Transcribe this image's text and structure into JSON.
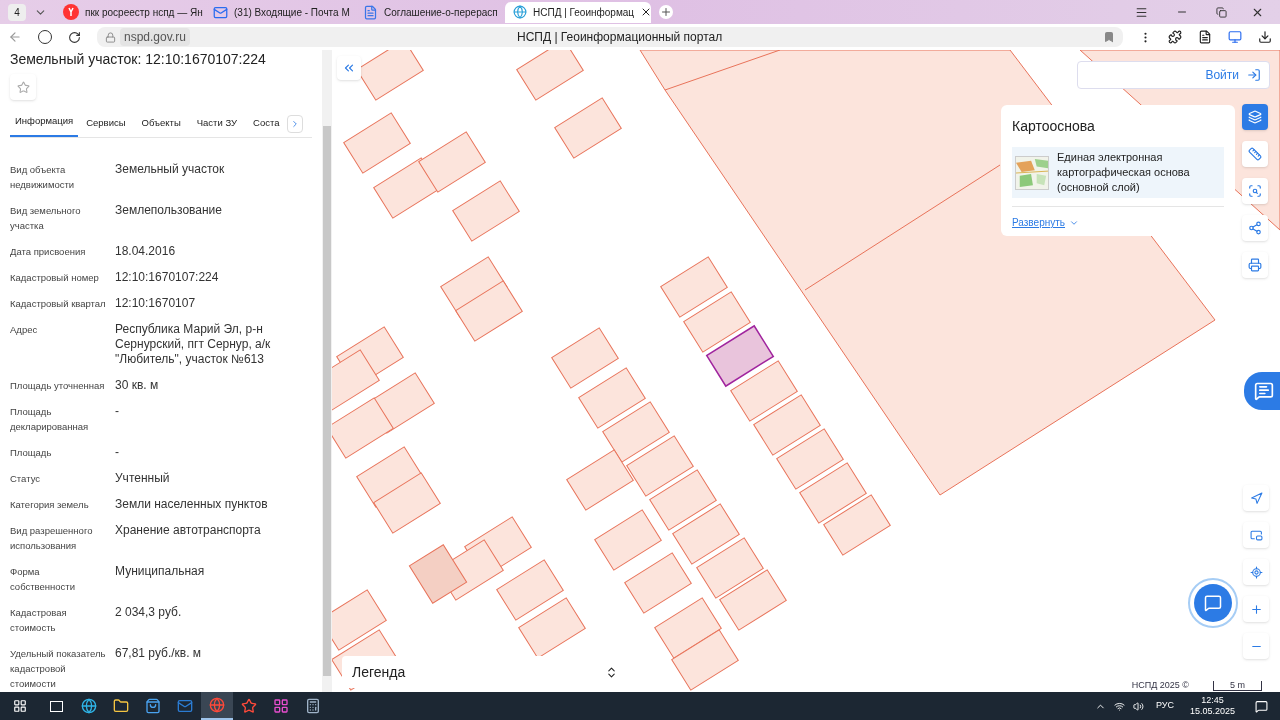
{
  "browser": {
    "tab_count": "4",
    "tabs": [
      {
        "title": "пкк росреестр нспд — Ян",
        "selected": false,
        "kind": "search"
      },
      {
        "title": "(31) Входящие - Почта М",
        "selected": false,
        "kind": "mail"
      },
      {
        "title": "Соглашение-о-перерасп",
        "selected": false,
        "kind": "doc"
      },
      {
        "title": "НСПД | Геоинформац",
        "selected": true,
        "kind": "site"
      }
    ],
    "url": "nspd.gov.ru",
    "page_title": "НСПД | Геоинформационный портал"
  },
  "panel": {
    "title": "Земельный участок: 12:10:1670107:224",
    "tabs": [
      {
        "label": "Информация",
        "selected": true
      },
      {
        "label": "Сервисы",
        "selected": false
      },
      {
        "label": "Объекты",
        "selected": false
      },
      {
        "label": "Части ЗУ",
        "selected": false
      },
      {
        "label": "Соста",
        "selected": false
      }
    ],
    "fields": [
      {
        "label": "Вид объекта недвижимости",
        "value": "Земельный участок"
      },
      {
        "label": "Вид земельного участка",
        "value": "Землепользование"
      },
      {
        "label": "Дата присвоения",
        "value": "18.04.2016"
      },
      {
        "label": "Кадастровый номер",
        "value": "12:10:1670107:224"
      },
      {
        "label": "Кадастровый квартал",
        "value": "12:10:1670107"
      },
      {
        "label": "Адрес",
        "value": "Республика Марий Эл, р-н Сернурский, пгт Сернур, а/к \"Любитель\", участок №613"
      },
      {
        "label": "Площадь уточненная",
        "value": "30 кв. м"
      },
      {
        "label": "Площадь декларированная",
        "value": "-"
      },
      {
        "label": "Площадь",
        "value": "-"
      },
      {
        "label": "Статус",
        "value": "Учтенный"
      },
      {
        "label": "Категория земель",
        "value": "Земли населенных пунктов"
      },
      {
        "label": "Вид разрешенного использования",
        "value": "Хранение автотранспорта"
      },
      {
        "label": "Форма собственности",
        "value": "Муниципальная"
      },
      {
        "label": "Кадастровая стоимость",
        "value": "2 034,3 руб."
      },
      {
        "label": "Удельный показатель кадастровой стоимости",
        "value": "67,81 руб./кв. м"
      }
    ]
  },
  "map": {
    "login_button": "Войти",
    "basemap": {
      "title": "Картооснова",
      "layer_name": "Единая электронная картографическая основа (основной слой)",
      "expand_link": "Развернуть"
    },
    "tools": [
      {
        "kind": "layers",
        "selected": true
      },
      {
        "kind": "ruler",
        "selected": false
      },
      {
        "kind": "select",
        "selected": false
      },
      {
        "kind": "share",
        "selected": false
      },
      {
        "kind": "print",
        "selected": false
      }
    ],
    "legend_title": "Легенда",
    "copyright": "НСПД 2025 ©",
    "scale": "5 m"
  },
  "taskbar": {
    "apps": [
      {
        "kind": "edge",
        "selected": false
      },
      {
        "kind": "explorer",
        "selected": false
      },
      {
        "kind": "store",
        "selected": false
      },
      {
        "kind": "outlook",
        "selected": false
      },
      {
        "kind": "yabrowser",
        "selected": true
      },
      {
        "kind": "yandex",
        "selected": false
      },
      {
        "kind": "colors",
        "selected": false
      },
      {
        "kind": "calculator",
        "selected": false
      }
    ],
    "language": "РУС",
    "time": "12:45",
    "date": "15.05.2025"
  }
}
